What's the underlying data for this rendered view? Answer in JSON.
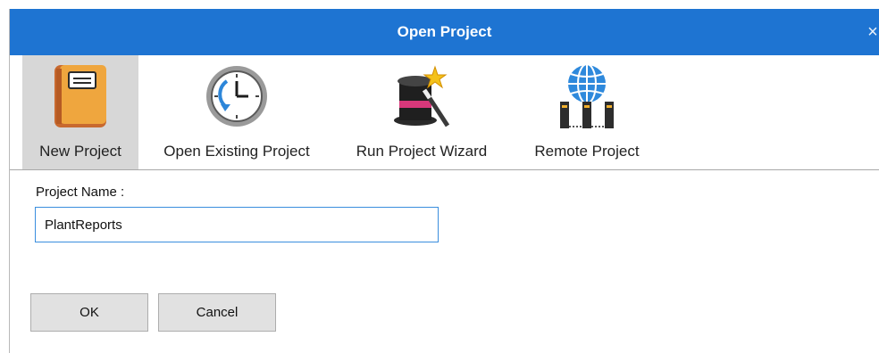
{
  "dialog": {
    "title": "Open Project",
    "close_glyph": "×"
  },
  "toolbar": {
    "items": [
      {
        "label": "New Project",
        "icon": "notebook-icon",
        "selected": true
      },
      {
        "label": "Open Existing Project",
        "icon": "clock-icon",
        "selected": false
      },
      {
        "label": "Run Project Wizard",
        "icon": "magic-hat-icon",
        "selected": false
      },
      {
        "label": "Remote Project",
        "icon": "globe-servers-icon",
        "selected": false
      }
    ]
  },
  "form": {
    "project_name_label": "Project Name :",
    "project_name_value": "PlantReports"
  },
  "buttons": {
    "ok_label": "OK",
    "cancel_label": "Cancel"
  },
  "colors": {
    "titlebar": "#1e74d2",
    "selected_tool": "#d7d7d7",
    "input_border": "#3a8ede"
  }
}
